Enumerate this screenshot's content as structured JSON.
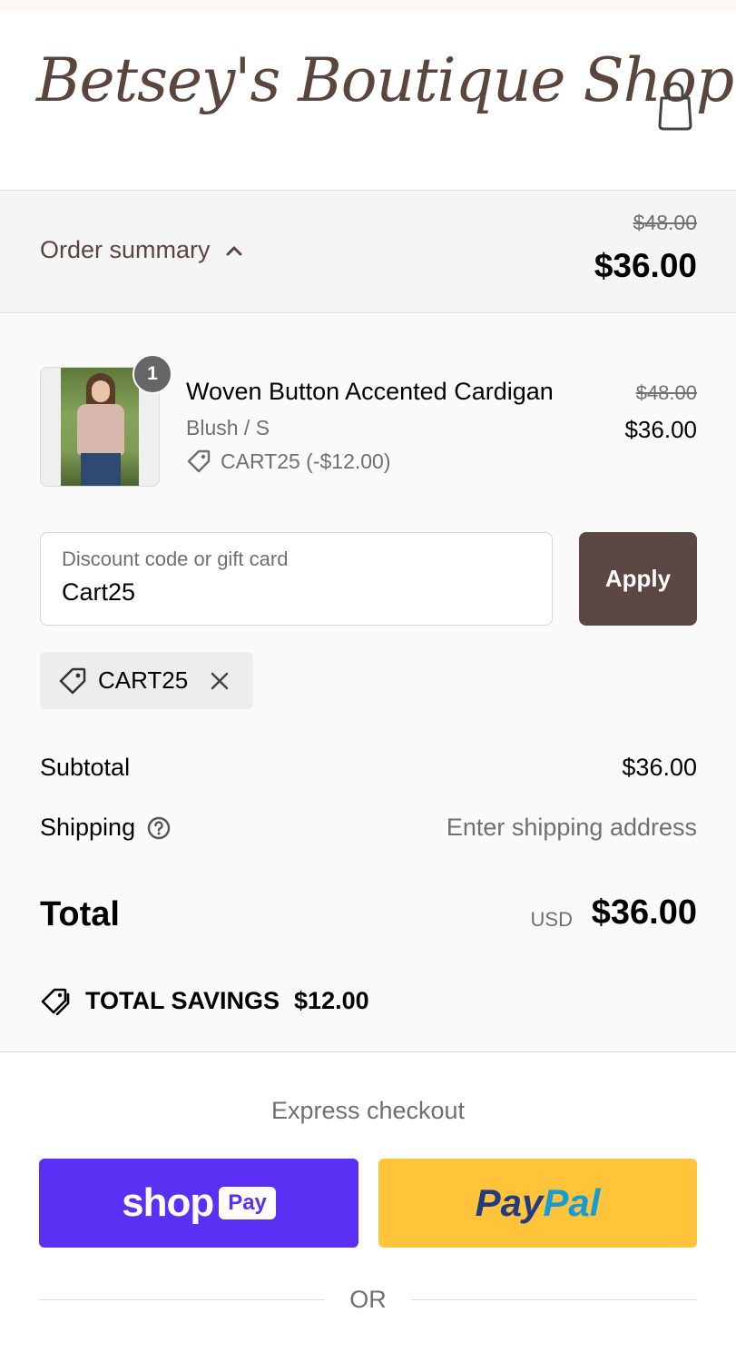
{
  "header": {
    "logo_text": "Betsey's Boutique Shop",
    "cart_icon": "shopping-bag-icon"
  },
  "summary": {
    "toggle_label": "Order summary",
    "toggle_icon": "chevron-up-icon",
    "original_price": "$48.00",
    "price": "$36.00"
  },
  "item": {
    "quantity": "1",
    "name": "Woven Button Accented Cardigan",
    "variant": "Blush / S",
    "discount": "CART25 (-$12.00)",
    "original_price": "$48.00",
    "price": "$36.00"
  },
  "discount_form": {
    "label": "Discount code or gift card",
    "value": "Cart25",
    "apply_label": "Apply",
    "applied_code": "CART25"
  },
  "totals": {
    "subtotal_label": "Subtotal",
    "subtotal_value": "$36.00",
    "shipping_label": "Shipping",
    "shipping_value": "Enter shipping address",
    "total_label": "Total",
    "currency": "USD",
    "total_value": "$36.00",
    "savings_label": "TOTAL SAVINGS",
    "savings_value": "$12.00"
  },
  "express": {
    "title": "Express checkout",
    "shoppay_word": "shop",
    "shoppay_pill": "Pay",
    "paypal_pay": "Pay",
    "paypal_pal": "Pal",
    "or_text": "OR"
  },
  "colors": {
    "brand_brown": "#5c4742",
    "shoppay_purple": "#5a31f4",
    "paypal_yellow": "#ffc439"
  }
}
